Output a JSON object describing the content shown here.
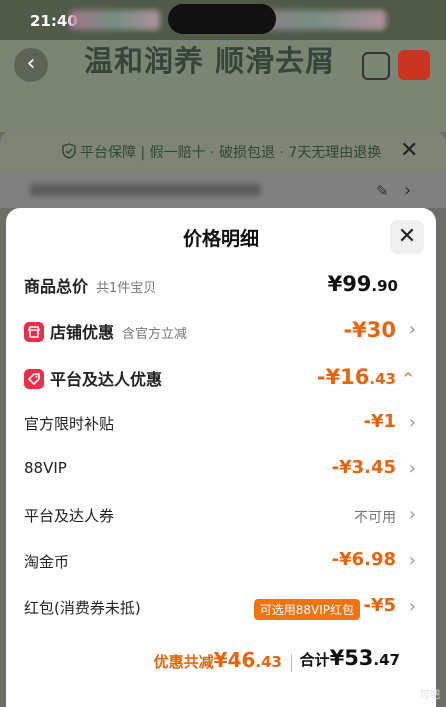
{
  "status_bar": {
    "time": "21:40"
  },
  "banner": {
    "title": "温和润养 顺滑去屑"
  },
  "guarantee": {
    "text": "平台保障 | 假一赔十 · 破损包退 · 7天无理由退换"
  },
  "sheet": {
    "title": "价格明细",
    "rows": [
      {
        "label": "商品总价",
        "sub": "共1件宝贝",
        "value_main": "¥99",
        "value_dec": ".90"
      },
      {
        "label": "店铺优惠",
        "sub": "含官方立减",
        "value_main": "-¥30",
        "value_dec": ""
      },
      {
        "label": "平台及达人优惠",
        "sub": "",
        "value_main": "-¥16",
        "value_dec": ".43"
      },
      {
        "label": "官方限时补贴",
        "value": "-¥1"
      },
      {
        "label": "88VIP",
        "value": "-¥3.45"
      },
      {
        "label": "平台及达人券",
        "value": "不可用"
      },
      {
        "label": "淘金币",
        "value": "-¥6.98"
      },
      {
        "label": "红包(消费券未抵)",
        "badge": "可选用88VIP红包",
        "value": "-¥5"
      }
    ],
    "summary": {
      "saved_label": "优惠共减",
      "saved_main": "¥46",
      "saved_dec": ".43",
      "total_label": "合计",
      "total_main": "¥53",
      "total_dec": ".47"
    }
  },
  "watermark": "可吧",
  "colors": {
    "accent": "#e8630a",
    "badge_red": "#ef2d48",
    "pill": "#f2730f"
  },
  "icons": [
    "shield-icon",
    "close-icon",
    "chevron-right-icon",
    "chevron-up-icon",
    "store-icon",
    "coupon-tag-icon",
    "edit-icon",
    "back-icon"
  ]
}
